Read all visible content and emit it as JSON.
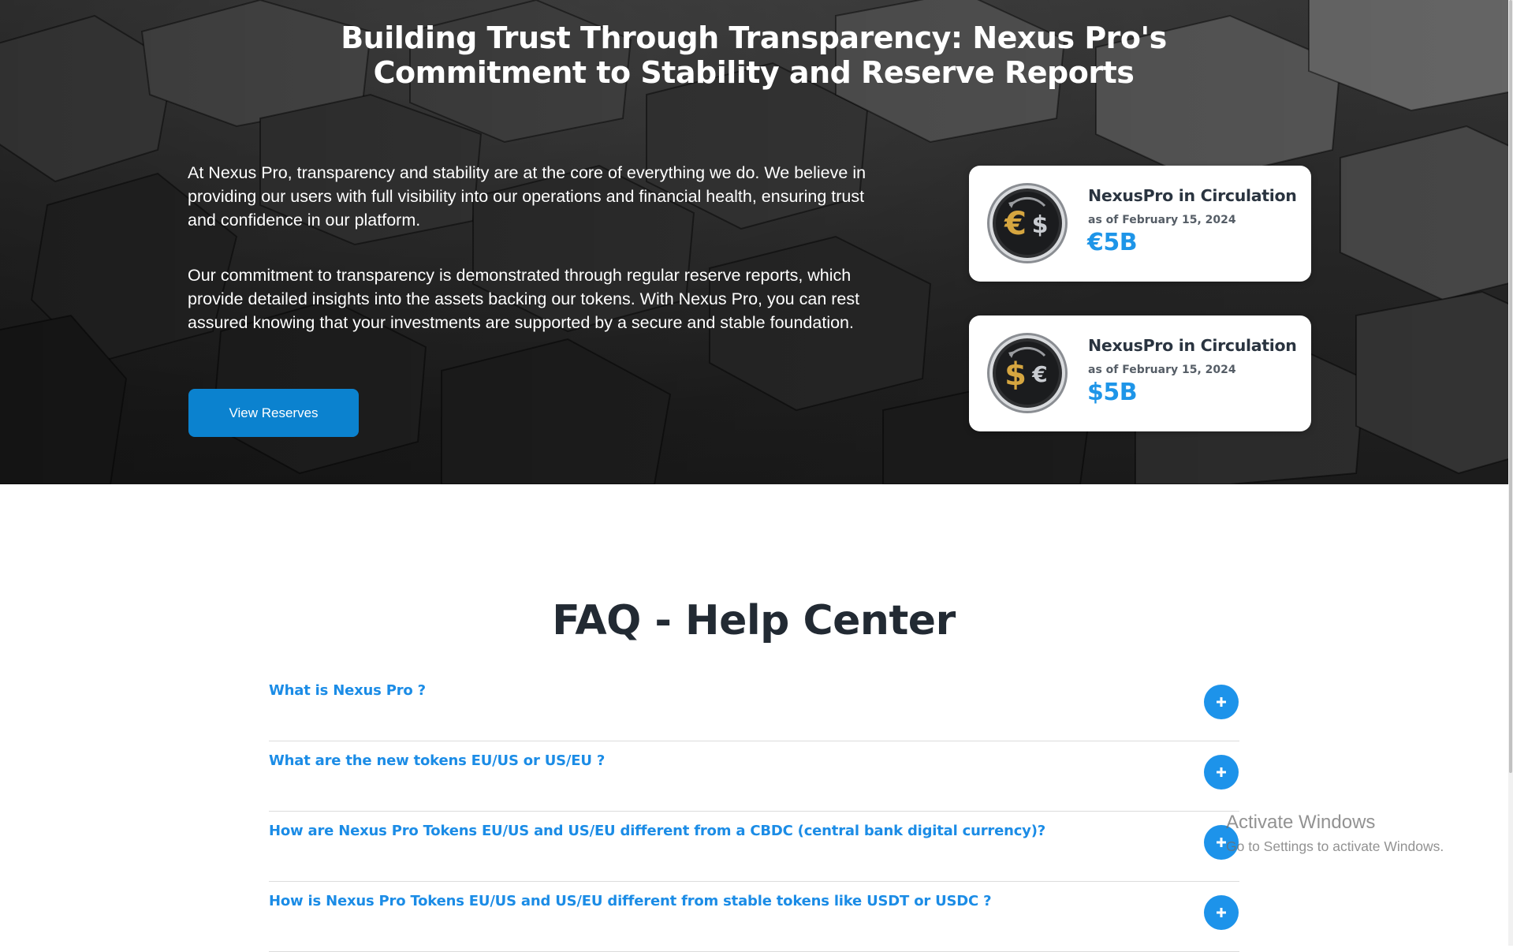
{
  "hero": {
    "title": "Building Trust Through Transparency: Nexus Pro's Commitment to Stability and Reserve Reports",
    "paragraph1": "At Nexus Pro, transparency and stability are at the core of everything we do. We believe in providing our users with full visibility into our operations and financial health, ensuring trust and confidence in our platform.",
    "paragraph2": "Our commitment to transparency is demonstrated through regular reserve reports, which provide detailed insights into the assets backing our tokens. With Nexus Pro, you can rest assured knowing that your investments are supported by a secure and stable foundation.",
    "button_label": "View Reserves",
    "background_icon": "dark-hexagon-blocks"
  },
  "cards": [
    {
      "icon": "euro-dollar-coin-icon",
      "title": "NexusPro in Circulation",
      "date": "as of February 15, 2024",
      "amount": "€5B"
    },
    {
      "icon": "dollar-euro-coin-icon",
      "title": "NexusPro in Circulation",
      "date": "as of February 15, 2024",
      "amount": "$5B"
    }
  ],
  "faq": {
    "title": "FAQ - Help Center",
    "items": [
      {
        "question": "What is Nexus Pro ?",
        "toggle_icon": "plus-icon"
      },
      {
        "question": "What are the new tokens EU/US or US/EU ?",
        "toggle_icon": "plus-icon"
      },
      {
        "question": "How are Nexus Pro Tokens EU/US and US/EU different from a CBDC (central bank digital currency)?",
        "toggle_icon": "plus-icon"
      },
      {
        "question": "How is Nexus Pro Tokens EU/US and US/EU different from stable tokens like USDT or USDC ?",
        "toggle_icon": "plus-icon"
      }
    ]
  },
  "watermark": {
    "line1": "Activate Windows",
    "line2": "Go to Settings to activate Windows."
  },
  "colors": {
    "accent": "#1e95e8",
    "button": "#0b82cf",
    "heading": "#222a33",
    "gold": "#d6a640",
    "silver": "#c9ccd1"
  }
}
